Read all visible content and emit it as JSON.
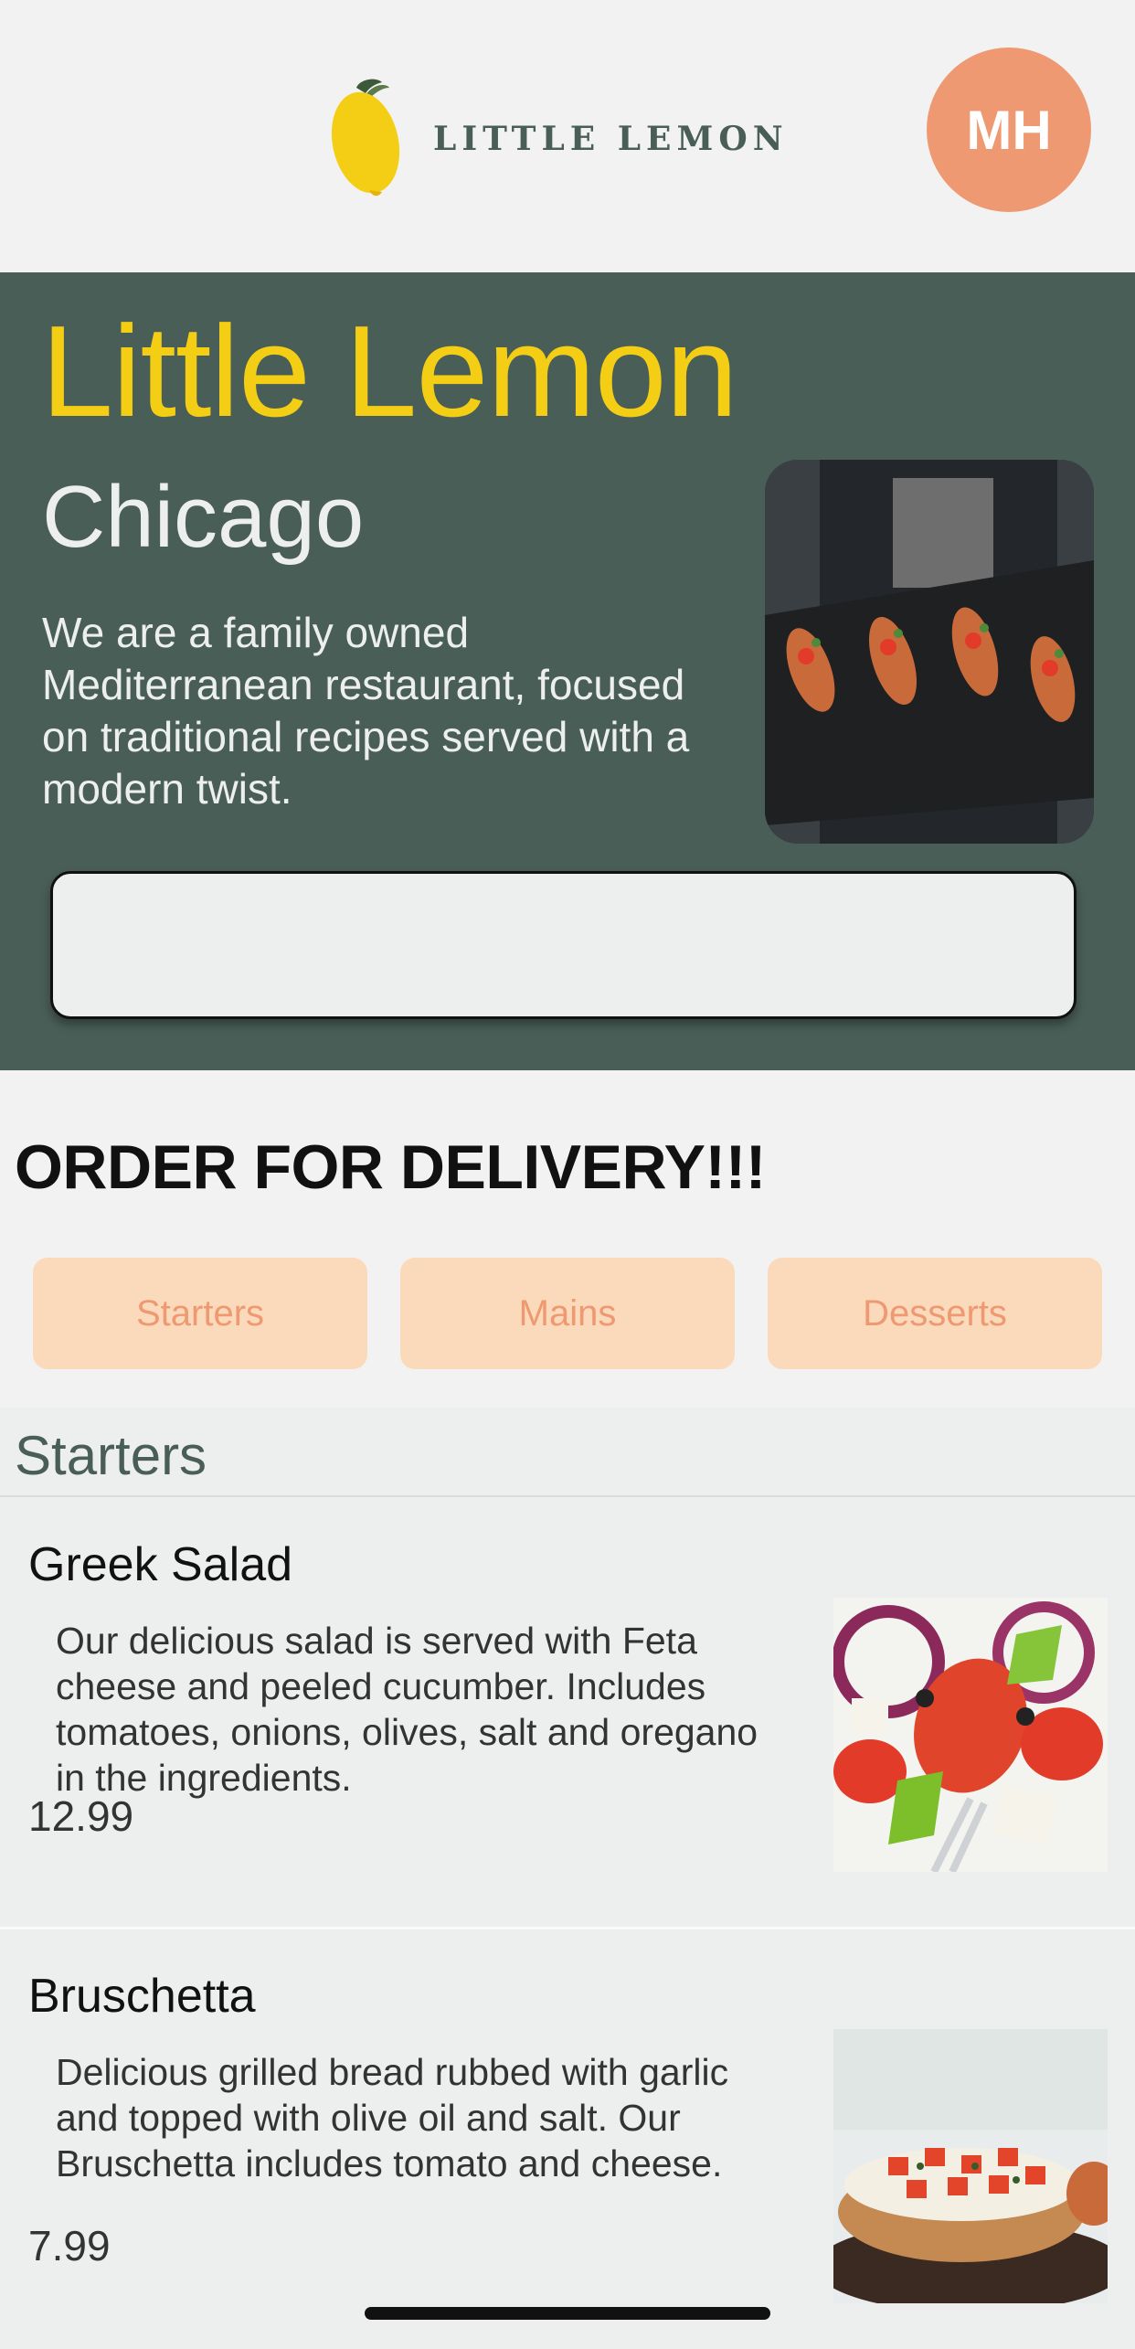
{
  "header": {
    "logo_text": "LITTLE LEMON",
    "avatar_initials": "MH"
  },
  "hero": {
    "title": "Little Lemon",
    "city": "Chicago",
    "description": "We are a family owned Mediterranean restaurant, focused on traditional recipes served with a modern twist.",
    "search_value": ""
  },
  "order": {
    "title": "ORDER FOR DELIVERY!!!",
    "categories": [
      "Starters",
      "Mains",
      "Desserts"
    ]
  },
  "menu": {
    "section_title": "Starters",
    "items": [
      {
        "name": "Greek Salad",
        "description": "Our delicious salad is served with Feta cheese and peeled cucumber. Includes tomatoes, onions, olives, salt and oregano in the ingredients.",
        "price": "12.99"
      },
      {
        "name": "Bruschetta",
        "description": "Delicious grilled bread rubbed with garlic and topped with olive oil and salt. Our Bruschetta includes tomato and cheese.",
        "price": "7.99"
      }
    ]
  },
  "colors": {
    "primary_green": "#495e57",
    "primary_yellow": "#f4ce14",
    "accent_salmon": "#ee9972",
    "accent_peach": "#fbdabb",
    "highlight_light": "#edefee"
  }
}
